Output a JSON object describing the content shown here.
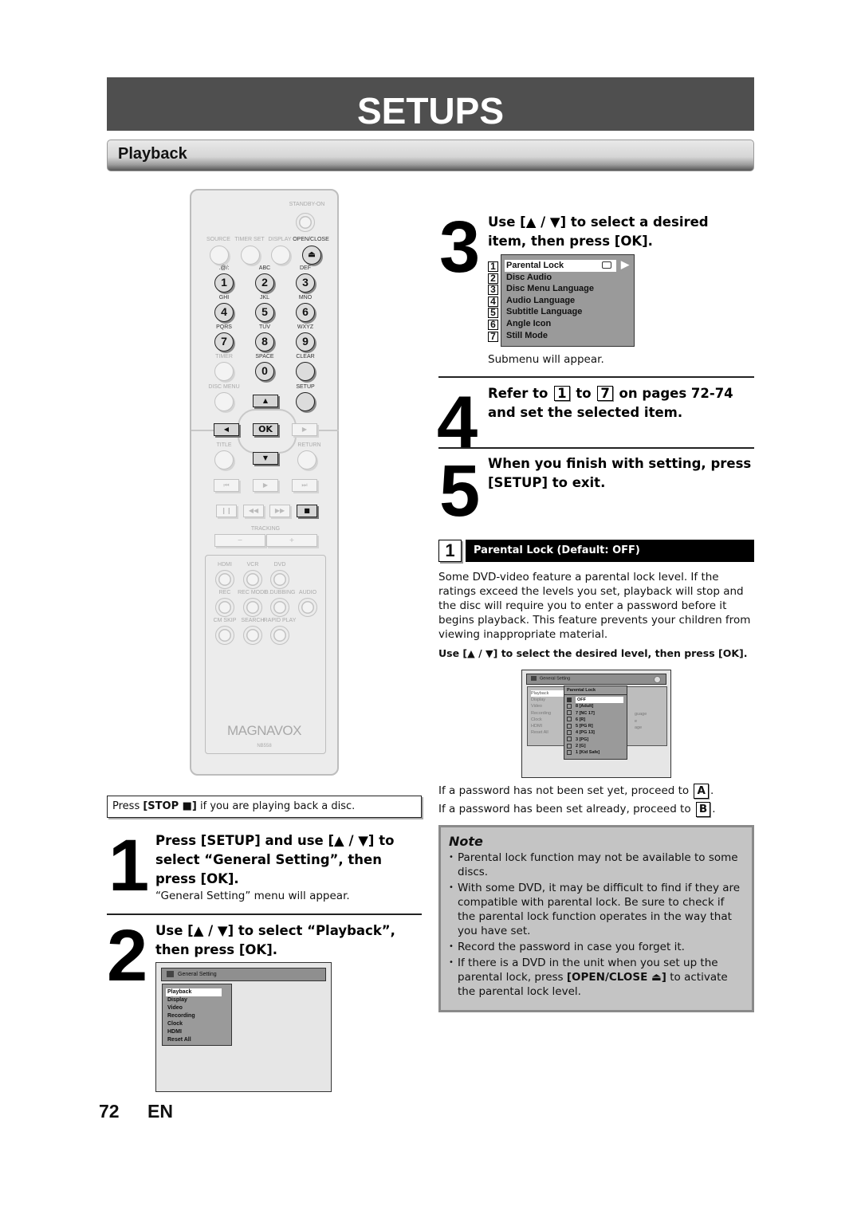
{
  "header": {
    "title": "SETUPS",
    "section": "Playback"
  },
  "remote": {
    "brand": "MAGNAVOX",
    "model": "NB558",
    "labels": {
      "standby": "STANDBY-ON",
      "source": "SOURCE",
      "timer_set": "TIMER SET",
      "display": "DISPLAY",
      "open_close": "OPEN/CLOSE",
      "k1": ".@/:",
      "k2": "ABC",
      "k3": "DEF",
      "k4": "GHI",
      "k5": "JKL",
      "k6": "MNO",
      "k7": "PQRS",
      "k8": "TUV",
      "k9": "WXYZ",
      "timer": "TIMER",
      "space": "SPACE",
      "clear": "CLEAR",
      "disc_menu": "DISC MENU",
      "setup": "SETUP",
      "title": "TITLE",
      "return": "RETURN",
      "tracking": "TRACKING",
      "hdmi": "HDMI",
      "vcr": "VCR",
      "dvd": "DVD",
      "rec": "REC",
      "rec_mode": "REC MODE",
      "d_dubbing": "D.DUBBING",
      "audio": "AUDIO",
      "cm_skip": "CM SKIP",
      "search": "SEARCH",
      "rapid_play": "RAPID PLAY"
    },
    "digits": [
      "1",
      "2",
      "3",
      "4",
      "5",
      "6",
      "7",
      "8",
      "9",
      "0"
    ],
    "ok": "OK",
    "minus": "−",
    "plus": "+"
  },
  "stop_note": {
    "pre": "Press ",
    "bold": "[STOP ■]",
    "post": " if you are playing back a disc."
  },
  "steps": [
    {
      "num": "1",
      "heading": "Press [SETUP] and use [▲ / ▼] to select “General Setting”, then press [OK].",
      "sub": "“General Setting” menu will appear."
    },
    {
      "num": "2",
      "heading": "Use [▲ / ▼] to select “Playback”, then press [OK]."
    },
    {
      "num": "3",
      "heading": "Use [▲ / ▼] to select a desired item, then press [OK].",
      "sub": "Submenu will appear."
    },
    {
      "num": "4",
      "heading_pre": "Refer to ",
      "box1": "1",
      "heading_mid": " to ",
      "box2": "7",
      "heading_post": " on pages 72-74 and set the selected item."
    },
    {
      "num": "5",
      "heading": "When you finish with setting, press [SETUP] to exit."
    }
  ],
  "general_menu": {
    "title": "General Setting",
    "items": [
      "Playback",
      "Display",
      "Video",
      "Recording",
      "Clock",
      "HDMI",
      "Reset All"
    ],
    "selected": "Playback"
  },
  "playback_menu": {
    "items": [
      {
        "num": "1",
        "label": "Parental Lock"
      },
      {
        "num": "2",
        "label": "Disc Audio"
      },
      {
        "num": "3",
        "label": "Disc Menu Language"
      },
      {
        "num": "4",
        "label": "Audio Language"
      },
      {
        "num": "5",
        "label": "Subtitle Language"
      },
      {
        "num": "6",
        "label": "Angle Icon"
      },
      {
        "num": "7",
        "label": "Still Mode"
      }
    ],
    "selected": "Parental Lock"
  },
  "parental_section": {
    "num": "1",
    "title": "Parental Lock (Default: OFF)",
    "desc": "Some DVD-video feature a parental lock level. If the ratings exceed the levels you set, playback will stop and the disc will require you to enter a password before it begins playback. This feature prevents your children from viewing inappropriate material.",
    "instruction": "Use [▲ / ▼] to select the desired level, then press [OK].",
    "osd": {
      "title": "General Setting",
      "submenu_title": "Parental Lock",
      "left_items": [
        "Playback",
        "Display",
        "Video",
        "Recording",
        "Clock",
        "HDMI",
        "Reset All"
      ],
      "levels": [
        "OFF",
        "8 [Adult]",
        "7 [NC 17]",
        "6 [R]",
        "5 [PG R]",
        "4 [PG 13]",
        "3 [PG]",
        "2 [G]",
        "1 [Kid Safe]"
      ],
      "checked": "OFF",
      "bg_fragments": [
        "guage",
        "e",
        "age"
      ]
    },
    "password_a": {
      "text": "If a password has not been set yet, proceed to ",
      "box": "A",
      "end": "."
    },
    "password_b": {
      "text": "If a password has been set already, proceed to ",
      "box": "B",
      "end": "."
    }
  },
  "note": {
    "title": "Note",
    "items": [
      "Parental lock function may not be available to some discs.",
      "With some DVD, it may be difficult to find if they are compatible with parental lock. Be sure to check if the parental lock function operates in the way that you have set.",
      "Record the password in case you forget it."
    ],
    "last_pre": "If there is a DVD in the unit when you set up the parental lock, press ",
    "last_bold": "[OPEN/CLOSE ⏏]",
    "last_post": " to activate the parental lock level."
  },
  "footer": {
    "page": "72",
    "lang": "EN"
  }
}
